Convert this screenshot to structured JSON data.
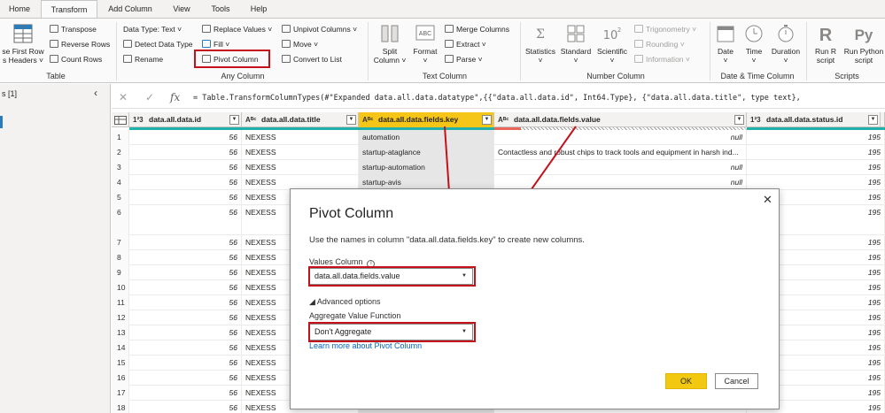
{
  "tabs": [
    "Home",
    "Transform",
    "Add Column",
    "View",
    "Tools",
    "Help"
  ],
  "ribbon": {
    "table": {
      "use_first_row_line1": "se First Row",
      "use_first_row_line2": "s Headers ˅",
      "transpose": "Transpose",
      "reverse_rows": "Reverse Rows",
      "count_rows": "Count Rows",
      "label": "Table"
    },
    "any_column": {
      "data_type": "Data Type: Text ˅",
      "detect_data_type": "Detect Data Type",
      "rename": "Rename",
      "replace_values": "Replace Values ˅",
      "fill": "Fill ˅",
      "pivot_column": "Pivot Column",
      "unpivot_columns": "Unpivot Columns ˅",
      "move": "Move ˅",
      "convert_to_list": "Convert to List",
      "label": "Any Column"
    },
    "text_column": {
      "split_column_line1": "Split",
      "split_column_line2": "Column ˅",
      "format_line1": "Format",
      "format_line2": "˅",
      "merge_columns": "Merge Columns",
      "extract": "Extract ˅",
      "parse": "Parse ˅",
      "label": "Text Column"
    },
    "number_column": {
      "statistics_line1": "Statistics",
      "statistics_line2": "˅",
      "standard_line1": "Standard",
      "standard_line2": "˅",
      "scientific_line1": "Scientific",
      "scientific_line2": "˅",
      "trigonometry": "Trigonometry ˅",
      "rounding": "Rounding ˅",
      "information": "Information ˅",
      "label": "Number Column"
    },
    "datetime_column": {
      "date_line1": "Date",
      "date_line2": "˅",
      "time_line1": "Time",
      "time_line2": "˅",
      "duration_line1": "Duration",
      "duration_line2": "˅",
      "label": "Date & Time Column"
    },
    "scripts": {
      "run_r_line1": "Run R",
      "run_r_line2": "script",
      "run_python_line1": "Run Python",
      "run_python_line2": "script",
      "label": "Scripts"
    }
  },
  "left_pane": {
    "title": "s [1]",
    "collapse": "‹"
  },
  "formula_bar": {
    "cancel": "✕",
    "commit": "✓",
    "fx": "fx",
    "formula": "= Table.TransformColumnTypes(#\"Expanded data.all.data.datatype\",{{\"data.all.data.id\", Int64.Type}, {\"data.all.data.title\", type text},"
  },
  "grid": {
    "columns": [
      {
        "type": "1²3",
        "name": "data.all.data.id"
      },
      {
        "type": "Aᴮᶜ",
        "name": "data.all.data.title"
      },
      {
        "type": "Aᴮᶜ",
        "name": "data.all.data.fields.key"
      },
      {
        "type": "Aᴮᶜ",
        "name": "data.all.data.fields.value"
      },
      {
        "type": "1²3",
        "name": "data.all.data.status.id"
      }
    ],
    "rows": [
      {
        "n": "1",
        "id": "56",
        "title": "NEXESS",
        "key": "automation",
        "value": "null",
        "status": "195"
      },
      {
        "n": "2",
        "id": "56",
        "title": "NEXESS",
        "key": "startup-ataglance",
        "value": "Contactless and robust chips to track tools and equipment in harsh ind...",
        "status": "195"
      },
      {
        "n": "3",
        "id": "56",
        "title": "NEXESS",
        "key": "startup-automation",
        "value": "null",
        "status": "195"
      },
      {
        "n": "4",
        "id": "56",
        "title": "NEXESS",
        "key": "startup-avis",
        "value": "null",
        "status": "195"
      },
      {
        "n": "5",
        "id": "56",
        "title": "NEXESS",
        "key": "",
        "value": "",
        "status": "195"
      },
      {
        "n": "6",
        "id": "56",
        "title": "NEXESS",
        "key": "",
        "value": "",
        "status": "195"
      },
      {
        "n": "7",
        "id": "56",
        "title": "NEXESS",
        "key": "",
        "value": "",
        "status": "195"
      },
      {
        "n": "8",
        "id": "56",
        "title": "NEXESS",
        "key": "",
        "value": "",
        "status": "195"
      },
      {
        "n": "9",
        "id": "56",
        "title": "NEXESS",
        "key": "",
        "value": "",
        "status": "195"
      },
      {
        "n": "10",
        "id": "56",
        "title": "NEXESS",
        "key": "",
        "value": "",
        "status": "195"
      },
      {
        "n": "11",
        "id": "56",
        "title": "NEXESS",
        "key": "",
        "value": "",
        "status": "195"
      },
      {
        "n": "12",
        "id": "56",
        "title": "NEXESS",
        "key": "",
        "value": "",
        "status": "195"
      },
      {
        "n": "13",
        "id": "56",
        "title": "NEXESS",
        "key": "",
        "value": "",
        "status": "195"
      },
      {
        "n": "14",
        "id": "56",
        "title": "NEXESS",
        "key": "",
        "value": "",
        "status": "195"
      },
      {
        "n": "15",
        "id": "56",
        "title": "NEXESS",
        "key": "",
        "value": "",
        "status": "195"
      },
      {
        "n": "16",
        "id": "56",
        "title": "NEXESS",
        "key": "",
        "value": "",
        "status": "195"
      },
      {
        "n": "17",
        "id": "56",
        "title": "NEXESS",
        "key": "",
        "value": "",
        "status": "195"
      },
      {
        "n": "18",
        "id": "56",
        "title": "NEXESS",
        "key": "",
        "value": "",
        "status": "195"
      }
    ]
  },
  "dialog": {
    "title": "Pivot Column",
    "close": "✕",
    "description": "Use the names in column \"data.all.data.fields.key\" to create new columns.",
    "values_column_label": "Values Column",
    "info_icon": "i",
    "values_column_value": "data.all.data.fields.value",
    "advanced_options": "◢ Advanced options",
    "aggregate_label": "Aggregate Value Function",
    "aggregate_value": "Don't Aggregate",
    "learn_more": "Learn more about Pivot Column",
    "ok": "OK",
    "cancel": "Cancel",
    "caret": "▼"
  },
  "colors": {
    "accent_yellow": "#f5c518",
    "highlight_red": "#c4111b",
    "link_blue": "#0563c1",
    "quality_green": "#20b2aa",
    "quality_red": "#e8665a"
  }
}
